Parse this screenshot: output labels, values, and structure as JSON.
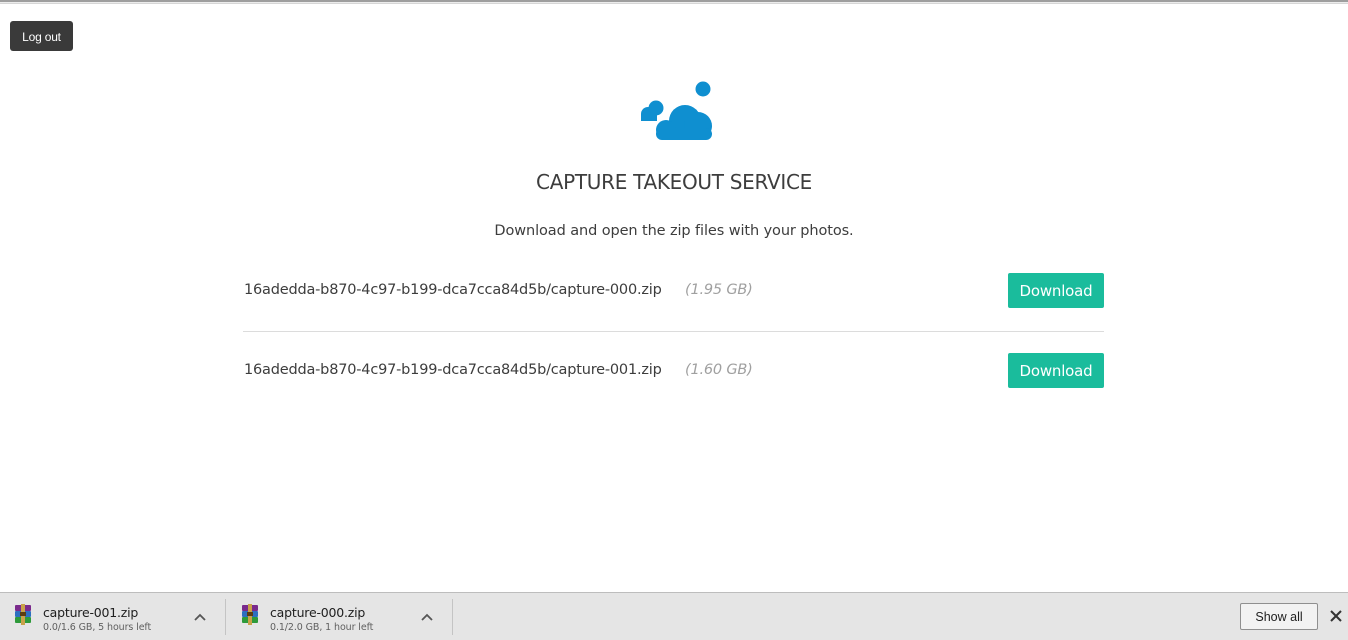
{
  "header": {
    "logout_label": "Log out"
  },
  "main": {
    "logo_icon": "cloud-logo-icon",
    "title": "CAPTURE TAKEOUT SERVICE",
    "subtitle": "Download and open the zip files with your photos.",
    "files": [
      {
        "name": "16adedda-b870-4c97-b199-dca7cca84d5b/capture-000.zip",
        "size": "(1.95 GB)",
        "button_label": "Download"
      },
      {
        "name": "16adedda-b870-4c97-b199-dca7cca84d5b/capture-001.zip",
        "size": "(1.60 GB)",
        "button_label": "Download"
      }
    ]
  },
  "download_shelf": {
    "items": [
      {
        "name": "capture-001.zip",
        "status": "0.0/1.6 GB, 5 hours left",
        "icon": "winrar-archive-icon"
      },
      {
        "name": "capture-000.zip",
        "status": "0.1/2.0 GB, 1 hour left",
        "icon": "winrar-archive-icon"
      }
    ],
    "show_all_label": "Show all"
  },
  "colors": {
    "accent": "#1abc9c",
    "logo": "#0f8fd0",
    "logout_bg": "#3a3a3a",
    "size_text": "#a0a0a0"
  }
}
